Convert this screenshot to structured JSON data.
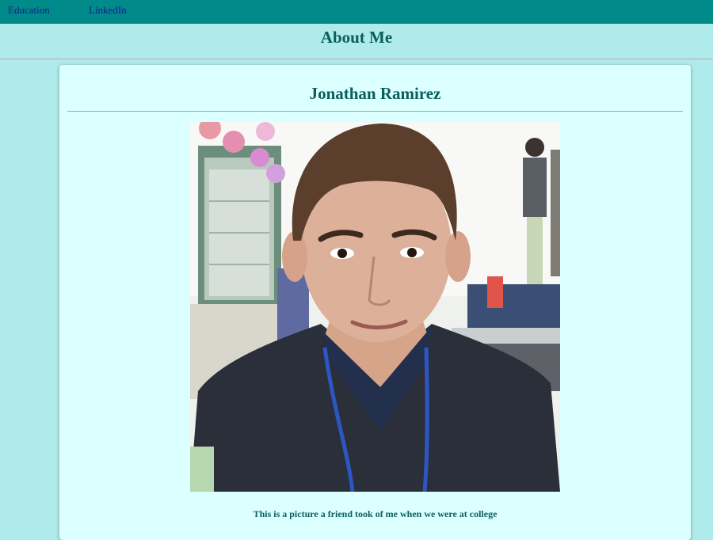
{
  "nav": {
    "items": [
      {
        "label": "Education"
      },
      {
        "label": "LinkedIn"
      }
    ]
  },
  "header": {
    "title": "About Me"
  },
  "profile": {
    "name": "Jonathan Ramirez",
    "photo_icon": "portrait-photo",
    "caption": "This is a picture a friend took of me when we were at college"
  },
  "colors": {
    "nav_bar": "#018a8a",
    "page_background": "#b0ebeb",
    "card_background": "#dcffff",
    "heading_text": "#0b5e5e",
    "link_text": "#1a1a8c"
  }
}
